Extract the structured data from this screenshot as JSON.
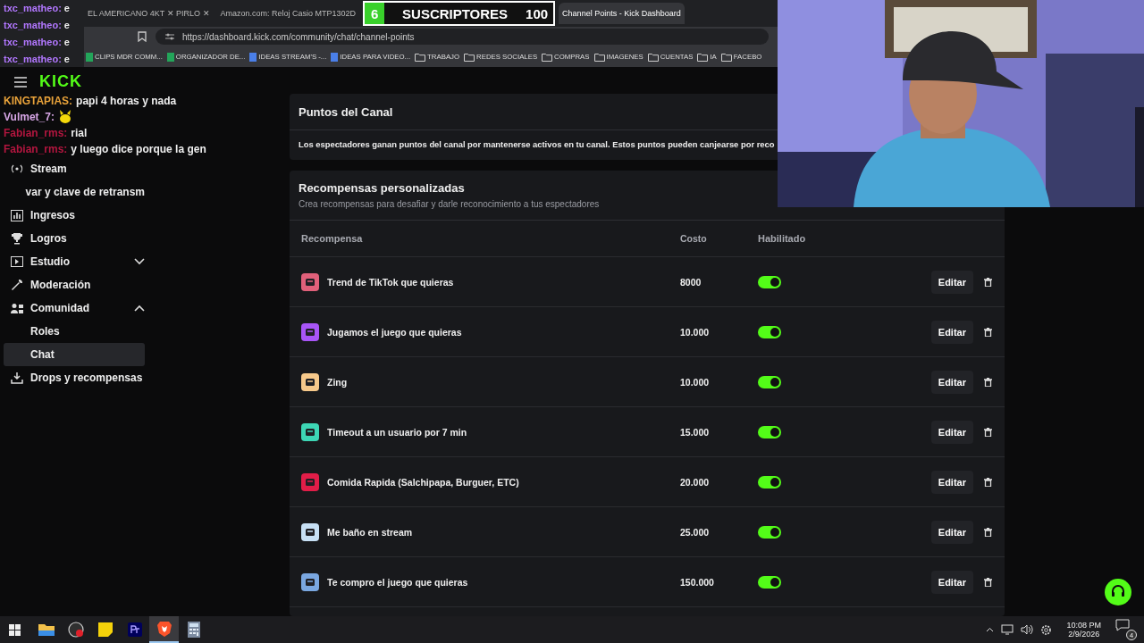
{
  "chat_overlay": [
    {
      "user": "txc_matheo:",
      "message": "e",
      "color": "#b277ff"
    },
    {
      "user": "txc_matheo:",
      "message": "e",
      "color": "#b277ff"
    },
    {
      "user": "txc_matheo:",
      "message": "e",
      "color": "#b277ff"
    },
    {
      "user": "txc_matheo:",
      "message": "e",
      "color": "#b277ff"
    }
  ],
  "tabs": [
    {
      "label": "EL AMERICANO 4KT ✕ PIRLO ✕",
      "selected": false
    },
    {
      "label": "Amazon.com: Reloj Casio MTP1302D",
      "selected": false
    },
    {
      "label": "Channel Points - Kick Dashboard",
      "selected": true
    }
  ],
  "subscriber_goal": {
    "count": "6",
    "label": "SUSCRIPTORES",
    "target": "100",
    "level": 0.06
  },
  "address_bar": {
    "url": "https://dashboard.kick.com/community/chat/channel-points"
  },
  "bookmarks": [
    {
      "label": "CLIPS MDR COMM...",
      "kind": "sheet"
    },
    {
      "label": "ORGANIZADOR DE...",
      "kind": "sheet"
    },
    {
      "label": "IDEAS STREAM'S -...",
      "kind": "doc"
    },
    {
      "label": "IDEAS PARA VIDEO...",
      "kind": "doc"
    },
    {
      "label": "TRABAJO",
      "kind": "folder"
    },
    {
      "label": "REDES SOCIALES",
      "kind": "folder"
    },
    {
      "label": "COMPRAS",
      "kind": "folder"
    },
    {
      "label": "IMAGENES",
      "kind": "folder"
    },
    {
      "label": "CUENTAS",
      "kind": "folder"
    },
    {
      "label": "IA",
      "kind": "folder"
    },
    {
      "label": "FACEBO",
      "kind": "folder"
    }
  ],
  "logo": "KICK",
  "stream_chat": [
    {
      "user": "KINGTAPIAS:",
      "message": "papi 4 horas y nada",
      "color": "#e8a23a",
      "emote": false
    },
    {
      "user": "Vulmet_7:",
      "color": "#d7a6e6",
      "emote": true
    },
    {
      "user": "Fabian_rms:",
      "message": "rial",
      "color": "#b3163f",
      "emote": false
    },
    {
      "user": "Fabian_rms:",
      "message": "y luego dice porque la gen",
      "color": "#b3163f",
      "emote": false
    }
  ],
  "sidebar": {
    "items": [
      {
        "label": "Stream",
        "kind": "stream",
        "selected": false
      },
      {
        "label": "var y clave de retransm",
        "kind": "none",
        "selected": false
      },
      {
        "label": "Ingresos",
        "kind": "chart",
        "selected": false
      },
      {
        "label": "Logros",
        "kind": "trophy",
        "selected": false
      },
      {
        "label": "Estudio",
        "kind": "studio",
        "expanded": false,
        "selected": false
      },
      {
        "label": "Moderación",
        "kind": "wrench",
        "selected": false
      },
      {
        "label": "Comunidad",
        "kind": "people",
        "expanded": true,
        "selected": false,
        "children": [
          {
            "label": "Roles",
            "selected": false
          },
          {
            "label": "Chat",
            "selected": true
          }
        ]
      },
      {
        "label": "Drops y recompensas",
        "kind": "drops",
        "selected": false
      }
    ]
  },
  "channel_points": {
    "title": "Puntos del Canal",
    "description": "Los espectadores ganan puntos del canal por mantenerse activos en tu canal. Estos puntos pueden canjearse por reco"
  },
  "custom_rewards": {
    "title": "Recompensas personalizadas",
    "subtitle": "Crea recompensas para desafiar y darle reconocimiento a tus espectadores",
    "columns": [
      "Recompensa",
      "Costo",
      "Habilitado"
    ],
    "rows": [
      {
        "name": "Trend de TikTok que quieras",
        "cost": "8000",
        "enabled": true,
        "color": "#e0607a",
        "edit": "Editar"
      },
      {
        "name": "Jugamos el juego que quieras",
        "cost": "10.000",
        "enabled": true,
        "color": "#a855f7",
        "edit": "Editar"
      },
      {
        "name": "Zing",
        "cost": "10.000",
        "enabled": true,
        "color": "#f7c98b",
        "edit": "Editar"
      },
      {
        "name": "Timeout a un usuario por 7 min",
        "cost": "15.000",
        "enabled": true,
        "color": "#3dd6b5",
        "edit": "Editar"
      },
      {
        "name": "Comida Rapida (Salchipapa, Burguer, ETC)",
        "cost": "20.000",
        "enabled": true,
        "color": "#e11d48",
        "edit": "Editar"
      },
      {
        "name": "Me baño en stream",
        "cost": "25.000",
        "enabled": true,
        "color": "#c7e0f5",
        "edit": "Editar"
      },
      {
        "name": "Te compro el juego que quieras",
        "cost": "150.000",
        "enabled": true,
        "color": "#7aa7e0",
        "edit": "Editar"
      }
    ]
  },
  "taskbar": {
    "apps": [
      {
        "kind": "folder",
        "running": false
      },
      {
        "kind": "recorder",
        "running": false
      },
      {
        "kind": "notes",
        "running": false
      },
      {
        "kind": "premiere",
        "running": false
      },
      {
        "kind": "browser",
        "running": true
      },
      {
        "kind": "calculator",
        "running": false
      }
    ],
    "time": "10:08 PM",
    "date": "2/9/2026",
    "notifications": "4"
  }
}
